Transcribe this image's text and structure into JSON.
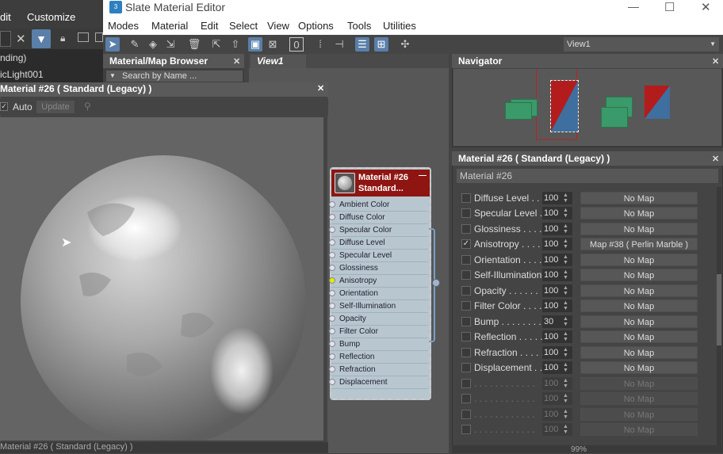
{
  "bg_app": {
    "menu": [
      "dit",
      "Customize"
    ],
    "list": [
      "nding)",
      "icLight001"
    ]
  },
  "window": {
    "title": "Slate Material Editor",
    "min": "—",
    "max": "☐",
    "close": "✕"
  },
  "menu": [
    "Modes",
    "Material",
    "Edit",
    "Select",
    "View",
    "Options",
    "Tools",
    "Utilities"
  ],
  "toolbar": {
    "view_dropdown": "View1"
  },
  "browser": {
    "title": "Material/Map Browser",
    "search_placeholder": "Search by Name ..."
  },
  "view_tab": "View1",
  "preview": {
    "title": "Material #26  ( Standard (Legacy) )",
    "auto_label": "Auto",
    "update_label": "Update",
    "status": "Material #26 ( Standard (Legacy) )"
  },
  "node": {
    "title": "Material #26",
    "subtitle": "Standard...",
    "slots": [
      "Ambient Color",
      "Diffuse Color",
      "Specular Color",
      "Diffuse Level",
      "Specular Level",
      "Glossiness",
      "Anisotropy",
      "Orientation",
      "Self-Illumination",
      "Opacity",
      "Filter Color",
      "Bump",
      "Reflection",
      "Refraction",
      "Displacement"
    ],
    "active_slot": 6
  },
  "navigator": {
    "title": "Navigator"
  },
  "params": {
    "title": "Material #26  ( Standard (Legacy) )",
    "name_value": "Material #26",
    "rows": [
      {
        "label": "Diffuse Level . . .",
        "value": "100",
        "map": "No Map",
        "checked": false
      },
      {
        "label": "Specular Level  .",
        "value": "100",
        "map": "No Map",
        "checked": false
      },
      {
        "label": "Glossiness  . . . .",
        "value": "100",
        "map": "No Map",
        "checked": false
      },
      {
        "label": "Anisotropy  . . . .",
        "value": "100",
        "map": "Map #38  ( Perlin Marble )",
        "checked": true
      },
      {
        "label": "Orientation  . . . .",
        "value": "100",
        "map": "No Map",
        "checked": false
      },
      {
        "label": "Self-Illumination .",
        "value": "100",
        "map": "No Map",
        "checked": false
      },
      {
        "label": "Opacity  . . . . . .",
        "value": "100",
        "map": "No Map",
        "checked": false
      },
      {
        "label": "Filter Color  . . . .",
        "value": "100",
        "map": "No Map",
        "checked": false
      },
      {
        "label": "Bump  . . . . . . . .",
        "value": "30",
        "map": "No Map",
        "checked": false
      },
      {
        "label": "Reflection  . . . . .",
        "value": "100",
        "map": "No Map",
        "checked": false
      },
      {
        "label": "Refraction  . . . . .",
        "value": "100",
        "map": "No Map",
        "checked": false
      },
      {
        "label": "Displacement  . .",
        "value": "100",
        "map": "No Map",
        "checked": false
      },
      {
        "label": ". . . . . . . . . . . .",
        "value": "100",
        "map": "No Map",
        "checked": false,
        "dim": true
      },
      {
        "label": ". . . . . . . . . . . .",
        "value": "100",
        "map": "No Map",
        "checked": false,
        "dim": true
      },
      {
        "label": ". . . . . . . . . . . .",
        "value": "100",
        "map": "No Map",
        "checked": false,
        "dim": true
      },
      {
        "label": ". . . . . . . . . . . .",
        "value": "100",
        "map": "No Map",
        "checked": false,
        "dim": true
      }
    ]
  },
  "bottom": {
    "zoom": "99%"
  },
  "colors": {
    "node_header": "#8e1512",
    "node_body": "#b8c6cf",
    "active_slot": "#e4ee00",
    "nav_green": "#3a9a6a",
    "nav_red": "#b31c1c",
    "nav_blue": "#3f6f9f"
  }
}
